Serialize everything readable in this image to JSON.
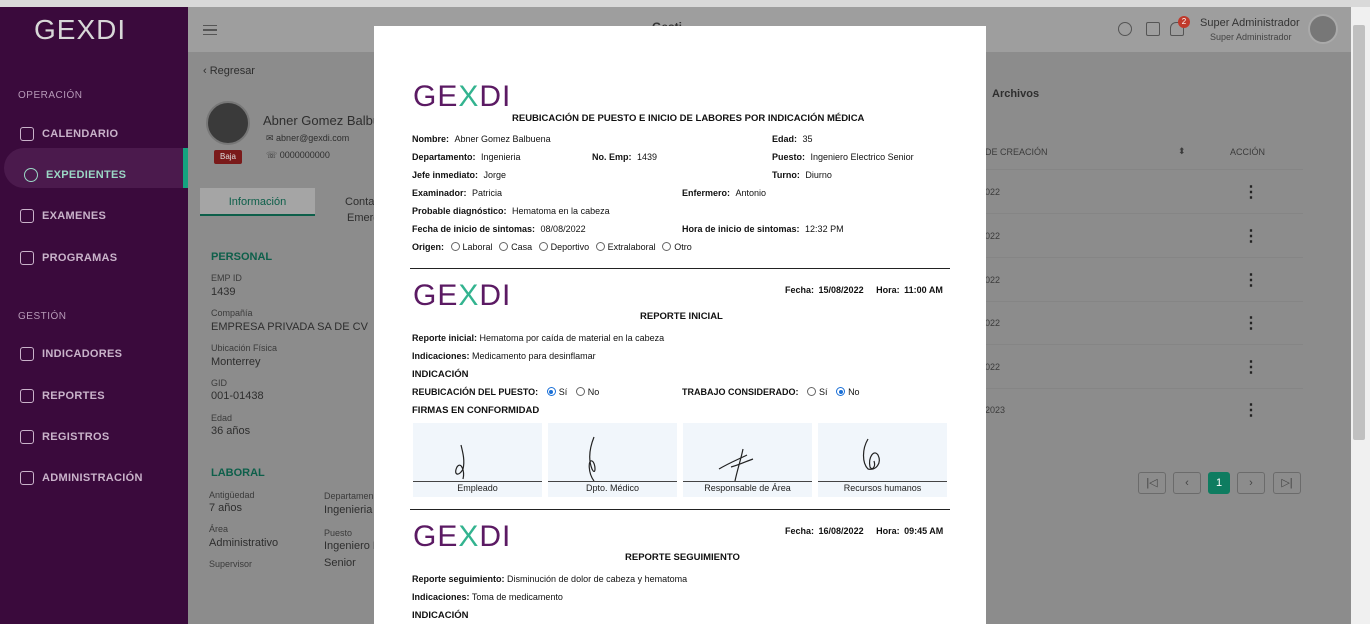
{
  "app": {
    "logo": "GEXDI",
    "header_title": "Gesti",
    "notification_count": "2",
    "user_name": "Super Administrador",
    "user_role": "Super Administrador"
  },
  "sidebar": {
    "section_operacion": "OPERACIÓN",
    "section_gestion": "GESTIÓN",
    "items": [
      {
        "label": "CALENDARIO",
        "icon": "calendar-icon"
      },
      {
        "label": "EXPEDIENTES",
        "icon": "asterisk-icon"
      },
      {
        "label": "EXAMENES",
        "icon": "edit-icon"
      },
      {
        "label": "PROGRAMAS",
        "icon": "pulse-icon"
      },
      {
        "label": "INDICADORES",
        "icon": "grid-icon"
      },
      {
        "label": "REPORTES",
        "icon": "pie-chart-icon"
      },
      {
        "label": "REGISTROS",
        "icon": "clipboard-icon"
      },
      {
        "label": "ADMINISTRACIÓN",
        "icon": "layers-icon"
      }
    ]
  },
  "background": {
    "back_label": "Regresar",
    "employee_name": "Abner Gomez Balbu",
    "employee_email": "abner@gexdi.com",
    "employee_phone": "0000000000",
    "status_badge": "Baja",
    "tab_info": "Información",
    "tab_contact": "Conta",
    "tab_contact2": "Emerg",
    "tab_files": "Archivos",
    "section_personal": "PERSONAL",
    "section_laboral": "LABORAL",
    "fields": {
      "emp_id_label": "EMP ID",
      "emp_id": "1439",
      "company_label": "Compañía",
      "company": "EMPRESA PRIVADA SA DE CV",
      "location_label": "Ubicación Física",
      "location": "Monterrey",
      "gid_label": "GID",
      "gid": "001-01438",
      "age_label": "Edad",
      "age": "36 años",
      "seniority_label": "Antigüedad",
      "seniority": "7 años",
      "area_label": "Área",
      "area": "Administrativo",
      "supervisor_label": "Supervisor",
      "department_label": "Departamen",
      "department": "Ingenieria",
      "position_label": "Puesto",
      "position": "Ingeniero E",
      "seniority_level": "Senior"
    },
    "table": {
      "col_created": "DE CREACIÓN",
      "col_action": "ACCIÓN",
      "rows": [
        "022",
        "022",
        "022",
        "022",
        "022",
        "2023"
      ]
    },
    "pager": {
      "first": "|◁",
      "prev": "‹",
      "current": "1",
      "next": "›",
      "last": "▷|"
    }
  },
  "modal": {
    "logo": "GEXDI",
    "form_title": "REUBICACIÓN DE PUESTO E INICIO DE LABORES POR INDICACIÓN MÉDICA",
    "nombre_label": "Nombre:",
    "nombre": "Abner Gomez Balbuena",
    "edad_label": "Edad:",
    "edad": "35",
    "departamento_label": "Departamento:",
    "departamento": "Ingenieria",
    "noemp_label": "No. Emp:",
    "noemp": "1439",
    "puesto_label": "Puesto:",
    "puesto": "Ingeniero Electrico Senior",
    "jefe_label": "Jefe inmediato:",
    "jefe": "Jorge",
    "turno_label": "Turno:",
    "turno": "Diurno",
    "examinador_label": "Examinador:",
    "examinador": "Patricia",
    "enfermero_label": "Enfermero:",
    "enfermero": "Antonio",
    "diagnostico_label": "Probable diagnóstico:",
    "diagnostico": "Hematoma en la cabeza",
    "fecha_sintomas_label": "Fecha de inicio de sintomas:",
    "fecha_sintomas": "08/08/2022",
    "hora_sintomas_label": "Hora de inicio de sintomas:",
    "hora_sintomas": "12:32 PM",
    "origen_label": "Origen:",
    "origen_options": [
      "Laboral",
      "Casa",
      "Deportivo",
      "Extralaboral",
      "Otro"
    ],
    "report1": {
      "fecha_label": "Fecha:",
      "fecha": "15/08/2022",
      "hora_label": "Hora:",
      "hora": "11:00 AM",
      "title": "REPORTE INICIAL",
      "reporte_label": "Reporte inicial:",
      "reporte": "Hematoma por caída de material en la cabeza",
      "indicaciones_label": "Indicaciones:",
      "indicaciones": "Medicamento para desinflamar",
      "indicacion_title": "INDICACIÓN",
      "reubicacion_label": "REUBICACIÓN DEL PUESTO:",
      "si": "Sí",
      "no": "No",
      "trabajo_label": "TRABAJO CONSIDERADO:",
      "firmas_title": "FIRMAS EN CONFORMIDAD",
      "signatures": [
        "Empleado",
        "Dpto. Médico",
        "Responsable de Área",
        "Recursos humanos"
      ]
    },
    "report2": {
      "fecha_label": "Fecha:",
      "fecha": "16/08/2022",
      "hora_label": "Hora:",
      "hora": "09:45 AM",
      "title": "REPORTE SEGUIMIENTO",
      "reporte_label": "Reporte seguimiento:",
      "reporte": "Disminución de dolor de cabeza y hematoma",
      "indicaciones_label": "Indicaciones:",
      "indicaciones": "Toma de medicamento",
      "indicacion_title": "INDICACIÓN"
    }
  },
  "colors": {
    "sidebar": "#3a0a3c",
    "accent": "#14a37f",
    "brand_purple": "#5b1a63",
    "brand_green": "#33b38f",
    "radio_selected": "#1a6fd6"
  }
}
